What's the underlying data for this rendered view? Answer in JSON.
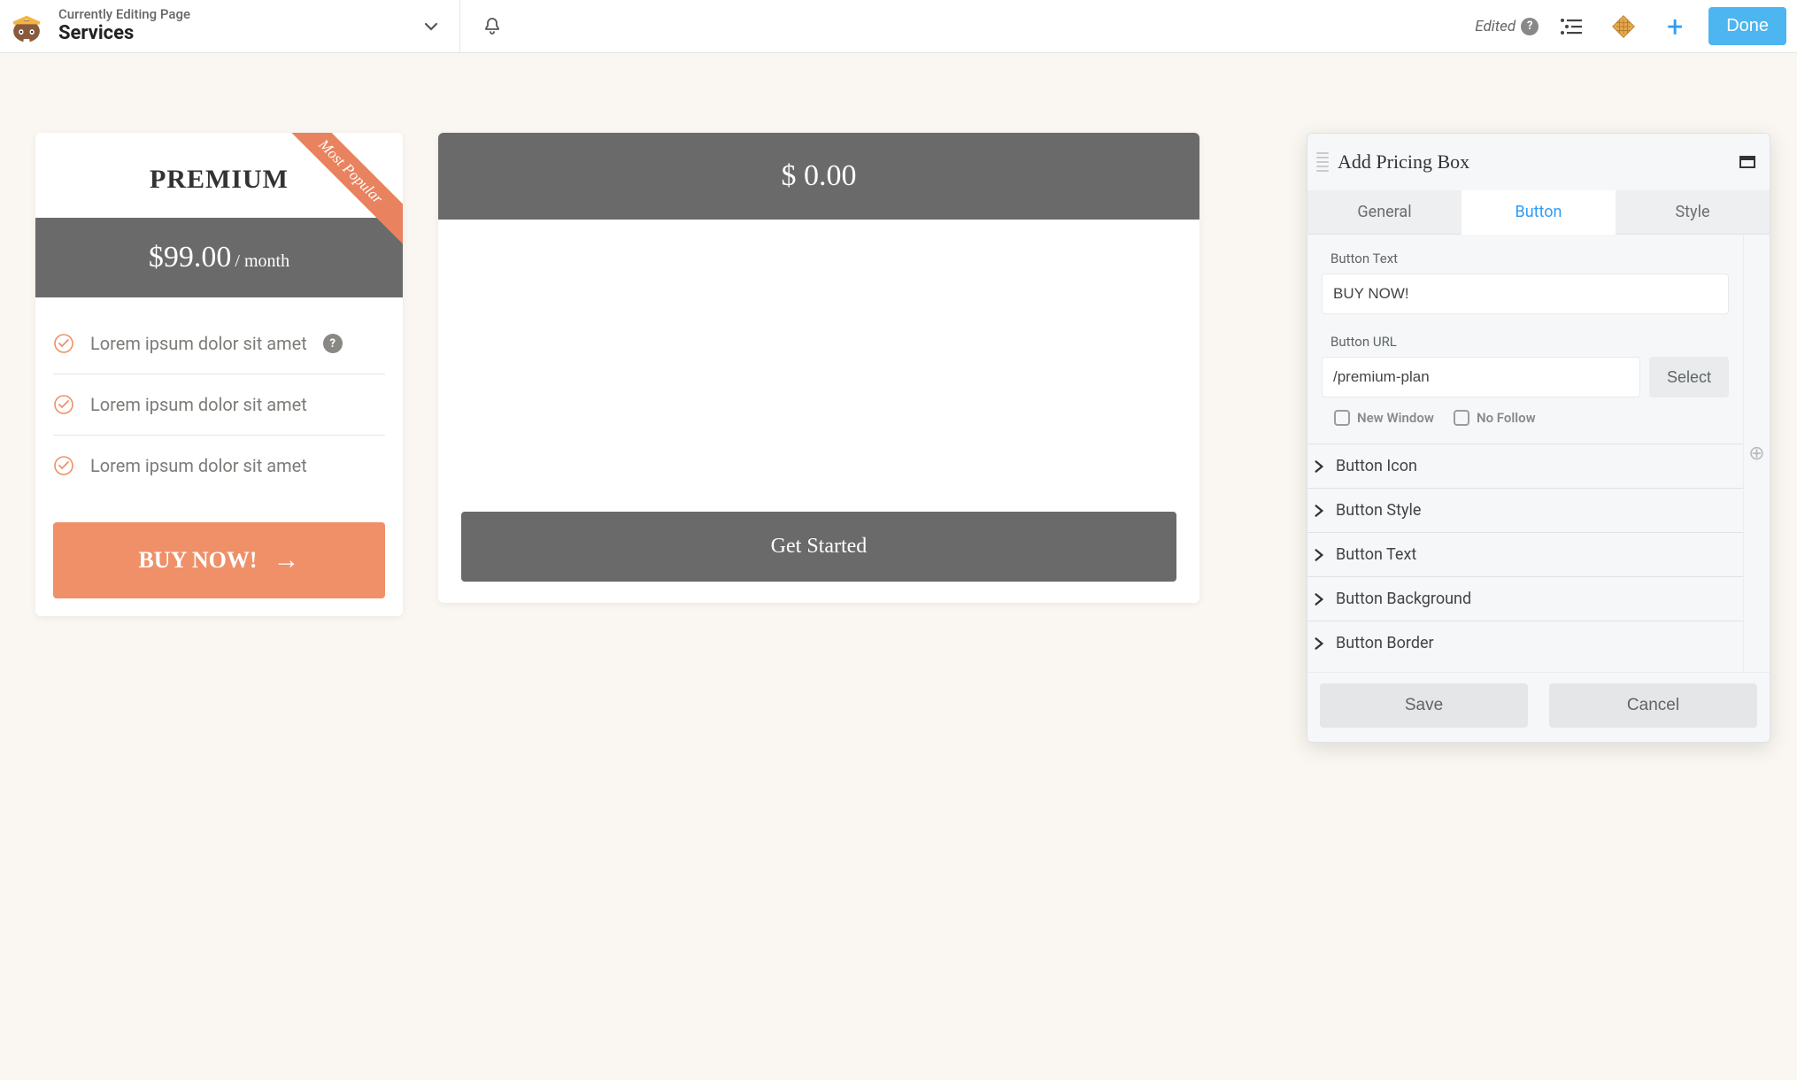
{
  "topbar": {
    "supertitle": "Currently Editing Page",
    "title": "Services",
    "edited_label": "Edited",
    "done_label": "Done"
  },
  "premium_card": {
    "title": "PREMIUM",
    "ribbon": "Most Popular",
    "price": "$99.00",
    "period": "/ month",
    "features": [
      "Lorem ipsum dolor sit amet",
      "Lorem ipsum dolor sit amet",
      "Lorem ipsum dolor sit amet"
    ],
    "cta": "BUY NOW!"
  },
  "basic_card": {
    "price": "$ 0.00",
    "cta": "Get Started"
  },
  "panel": {
    "title": "Add Pricing Box",
    "tabs": {
      "general": "General",
      "button": "Button",
      "style": "Style"
    },
    "fields": {
      "button_text_label": "Button Text",
      "button_text_value": "BUY NOW!",
      "button_url_label": "Button URL",
      "button_url_value": "/premium-plan",
      "select_label": "Select",
      "new_window": "New Window",
      "no_follow": "No Follow"
    },
    "accordion": [
      "Button Icon",
      "Button Style",
      "Button Text",
      "Button Background",
      "Button Border"
    ],
    "footer": {
      "save": "Save",
      "cancel": "Cancel"
    }
  }
}
